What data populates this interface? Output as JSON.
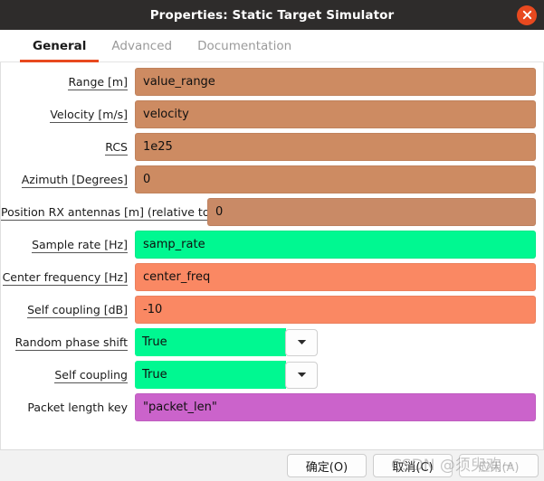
{
  "window": {
    "title": "Properties: Static Target Simulator",
    "close_icon": "close-icon"
  },
  "tabs": [
    {
      "label": "General",
      "active": true
    },
    {
      "label": "Advanced",
      "active": false
    },
    {
      "label": "Documentation",
      "active": false
    }
  ],
  "colors": {
    "title_bar": "#2e2c2b",
    "accent": "#e8491f",
    "field_tan": "#cd8b62",
    "field_tan_muted": "#c98a66",
    "field_green": "#00f891",
    "field_salmon": "#fa8863",
    "field_purple": "#cb63cb",
    "footer": "#f2f2f2"
  },
  "fields": [
    {
      "label": "Range [m]",
      "underline": true,
      "value": "value_range",
      "type": "text",
      "color": "#cd8b62",
      "wide_label": false
    },
    {
      "label": "Velocity [m/s]",
      "underline": true,
      "value": "velocity",
      "type": "text",
      "color": "#cd8b62",
      "wide_label": false
    },
    {
      "label": "RCS",
      "underline": true,
      "value": "1e25",
      "type": "text",
      "color": "#cd8b62",
      "wide_label": false
    },
    {
      "label": "Azimuth [Degrees]",
      "underline": true,
      "value": "0",
      "type": "text",
      "color": "#cd8b62",
      "wide_label": false
    },
    {
      "label": "Position RX antennas [m] (relative to TX)",
      "underline": true,
      "value": "0",
      "type": "text",
      "color": "#c98a66",
      "wide_label": true
    },
    {
      "label": "Sample rate [Hz]",
      "underline": true,
      "value": "samp_rate",
      "type": "text",
      "color": "#00f891",
      "wide_label": false
    },
    {
      "label": "Center frequency [Hz]",
      "underline": true,
      "value": "center_freq",
      "type": "text",
      "color": "#fa8863",
      "wide_label": false
    },
    {
      "label": "Self coupling [dB]",
      "underline": true,
      "value": "-10",
      "type": "text",
      "color": "#fa8863",
      "wide_label": false
    },
    {
      "label": "Random phase shift",
      "underline": true,
      "value": "True",
      "type": "combo",
      "color": "#00f891",
      "wide_label": false
    },
    {
      "label": "Self coupling",
      "underline": true,
      "value": "True",
      "type": "combo",
      "color": "#00f891",
      "wide_label": false
    },
    {
      "label": "Packet length key",
      "underline": false,
      "value": "\"packet_len\"",
      "type": "text",
      "color": "#cb63cb",
      "wide_label": false
    }
  ],
  "footer": {
    "buttons": [
      {
        "label": "确定(O)",
        "name": "ok-button",
        "muted": false
      },
      {
        "label": "取消(C)",
        "name": "cancel-button",
        "muted": false
      },
      {
        "label": "应用(A)",
        "name": "apply-button",
        "muted": true
      }
    ]
  },
  "watermark": {
    "text": "CSDN @须臾欢~"
  }
}
